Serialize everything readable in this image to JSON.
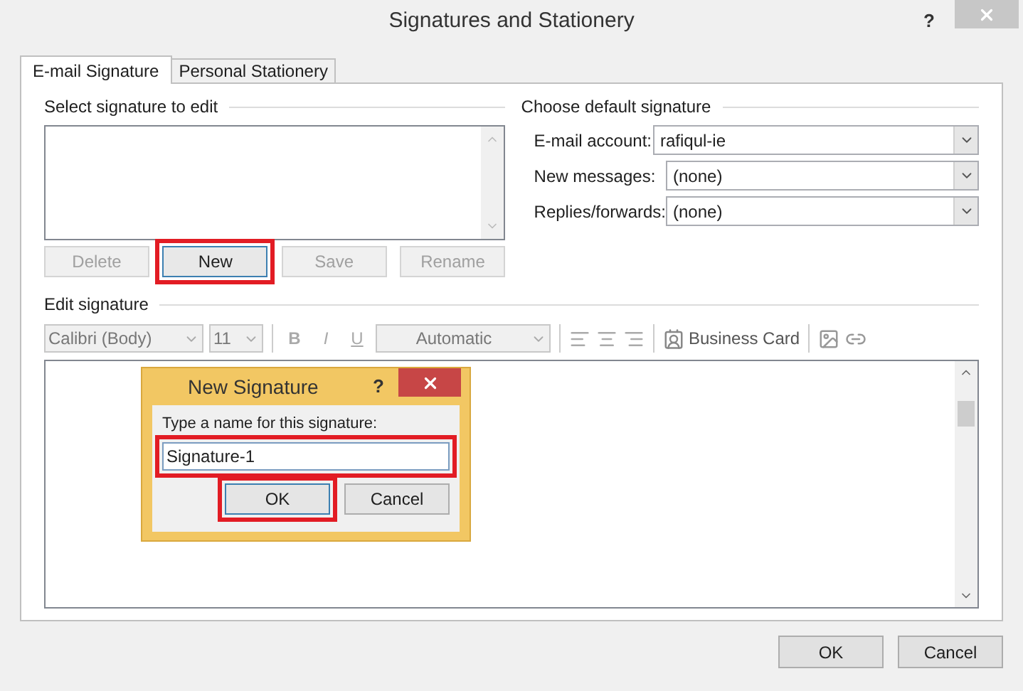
{
  "window": {
    "title": "Signatures and Stationery",
    "help": "?"
  },
  "tabs": [
    {
      "label": "E-mail Signature",
      "selected": true
    },
    {
      "label": "Personal Stationery",
      "selected": false
    }
  ],
  "select_signature": {
    "heading": "Select signature to edit",
    "buttons": [
      {
        "label": "Delete",
        "disabled": true,
        "highlighted": false
      },
      {
        "label": "New",
        "disabled": false,
        "highlighted": true
      },
      {
        "label": "Save",
        "disabled": true,
        "highlighted": false
      },
      {
        "label": "Rename",
        "disabled": true,
        "highlighted": false
      }
    ]
  },
  "default_signature": {
    "heading": "Choose default signature",
    "fields": [
      {
        "label": "E-mail account:",
        "value": "rafiqul-ie"
      },
      {
        "label": "New messages:",
        "value": "(none)"
      },
      {
        "label": "Replies/forwards:",
        "value": "(none)"
      }
    ]
  },
  "edit_signature": {
    "heading": "Edit signature",
    "font": "Calibri (Body)",
    "size": "11",
    "bold": "B",
    "italic": "I",
    "underline": "U",
    "color_picker": "Automatic",
    "business_card": "Business Card"
  },
  "new_signature_dialog": {
    "title": "New Signature",
    "help": "?",
    "prompt": "Type a name for this signature:",
    "value": "Signature-1",
    "field_highlighted": true,
    "buttons": [
      {
        "label": "OK",
        "highlighted": true
      },
      {
        "label": "Cancel",
        "highlighted": false
      }
    ]
  },
  "buttons": [
    {
      "label": "OK"
    },
    {
      "label": "Cancel"
    }
  ]
}
